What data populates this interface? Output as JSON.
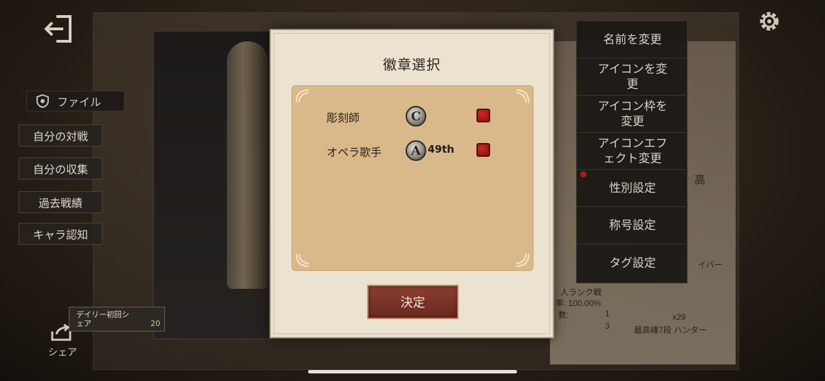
{
  "modal": {
    "title": "徽章選択",
    "badges": [
      {
        "name": "彫刻師",
        "icon_letter": "C",
        "rank": "",
        "checked": true
      },
      {
        "name": "オペラ歌手",
        "icon_letter": "A",
        "rank": "49th",
        "checked": true
      }
    ],
    "confirm_label": "決定"
  },
  "sidebar": {
    "file_tab": "ファイル",
    "items": [
      {
        "label": "自分の対戦"
      },
      {
        "label": "自分の収集"
      },
      {
        "label": "過去戦績"
      },
      {
        "label": "キャラ認知"
      }
    ],
    "daily_share": "デイリー初回シェア",
    "daily_share_line1": "デイリー初回シ",
    "daily_share_line2": "ェア",
    "daily_reward": "20",
    "share_label": "シェア"
  },
  "right_menu": {
    "items": [
      {
        "label": "名前を変更"
      },
      {
        "label": "アイコンを変更",
        "line1": "アイコンを変",
        "line2": "更"
      },
      {
        "label": "アイコン枠を変更",
        "line1": "アイコン枠を",
        "line2": "変更"
      },
      {
        "label": "アイコンエフェクト変更",
        "line1": "アイコンエフ",
        "line2": "ェクト変更"
      },
      {
        "label": "性別設定"
      },
      {
        "label": "称号設定"
      },
      {
        "label": "タグ設定"
      }
    ]
  },
  "background_stats": {
    "rank_mode": "人ランク戦",
    "win_rate": "率: 100.00%",
    "count_label": "数:",
    "count_value": "1",
    "count_value2": "3",
    "high_kanji": "高",
    "right_role": "イバー",
    "badge_count": "x29",
    "highest_rank": "最高峰7段 ハンター"
  },
  "colors": {
    "modal_bg": "#ece2d0",
    "panel_bg": "#d9b989",
    "confirm_btn": "#7a3228",
    "checkbox_red": "#b81c1c"
  }
}
